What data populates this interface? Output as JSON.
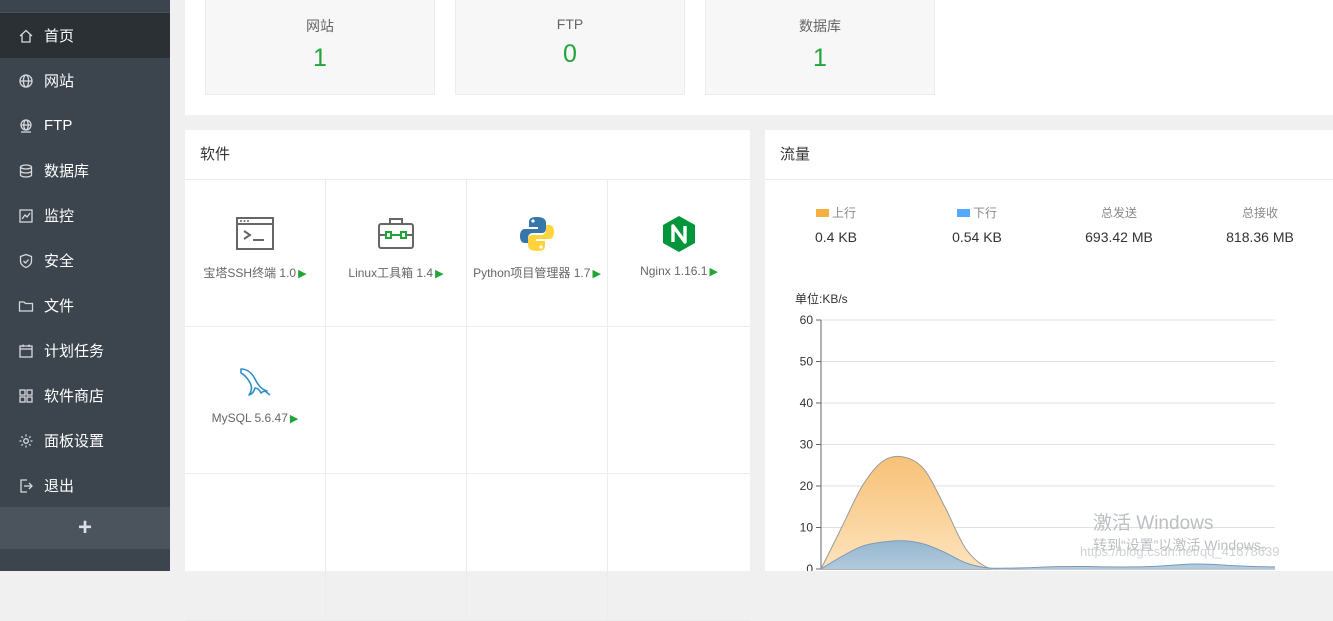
{
  "sidebar": {
    "items": [
      {
        "label": "首页",
        "icon": "home-icon",
        "active": true
      },
      {
        "label": "网站",
        "icon": "globe-icon"
      },
      {
        "label": "FTP",
        "icon": "ftp-globe-icon"
      },
      {
        "label": "数据库",
        "icon": "database-icon"
      },
      {
        "label": "监控",
        "icon": "monitor-icon"
      },
      {
        "label": "安全",
        "icon": "shield-icon"
      },
      {
        "label": "文件",
        "icon": "folder-icon"
      },
      {
        "label": "计划任务",
        "icon": "calendar-icon"
      },
      {
        "label": "软件商店",
        "icon": "grid-icon"
      },
      {
        "label": "面板设置",
        "icon": "gear-icon"
      },
      {
        "label": "退出",
        "icon": "logout-icon"
      }
    ],
    "add_label": "+"
  },
  "stats": [
    {
      "label": "网站",
      "value": "1"
    },
    {
      "label": "FTP",
      "value": "0"
    },
    {
      "label": "数据库",
      "value": "1"
    }
  ],
  "software": {
    "title": "软件",
    "items": [
      {
        "name": "宝塔SSH终端 1.0",
        "icon": "terminal-icon"
      },
      {
        "name": "Linux工具箱 1.4",
        "icon": "toolbox-icon"
      },
      {
        "name": "Python项目管理器 1.7",
        "icon": "python-icon"
      },
      {
        "name": "Nginx 1.16.1",
        "icon": "nginx-icon"
      },
      {
        "name": "MySQL 5.6.47",
        "icon": "mysql-icon"
      }
    ],
    "play_glyph": "▶"
  },
  "traffic": {
    "title": "流量",
    "stats": [
      {
        "label": "上行",
        "value": "0.4 KB",
        "color": "#f5b041"
      },
      {
        "label": "下行",
        "value": "0.54 KB",
        "color": "#52a9ff"
      },
      {
        "label": "总发送",
        "value": "693.42 MB"
      },
      {
        "label": "总接收",
        "value": "818.36 MB"
      }
    ],
    "unit_label": "单位:KB/s"
  },
  "chart_data": {
    "type": "area",
    "ylabel": "单位:KB/s",
    "ylim": [
      0,
      60
    ],
    "yticks": [
      0,
      10,
      20,
      30,
      40,
      50,
      60
    ],
    "series": [
      {
        "name": "上行",
        "color": "#f5b041",
        "values": [
          0,
          10,
          20,
          26,
          27,
          24,
          15,
          5,
          0.5,
          0,
          0,
          0,
          0,
          0,
          0,
          0,
          0,
          0,
          0,
          0,
          0,
          0,
          0
        ]
      },
      {
        "name": "下行",
        "color": "#52a9ff",
        "values": [
          0,
          3,
          5.5,
          6.5,
          6.8,
          6,
          4,
          1.5,
          0.3,
          0.2,
          0.3,
          0.5,
          0.6,
          0.6,
          0.5,
          0.5,
          0.6,
          0.9,
          1.2,
          1.1,
          0.8,
          0.6,
          0.5
        ]
      }
    ],
    "grid": true
  },
  "watermark": {
    "line1": "激活 Windows",
    "line2": "转到“设置”以激活 Windows。",
    "url": "https://blog.csdn.net/qq_41678639"
  }
}
